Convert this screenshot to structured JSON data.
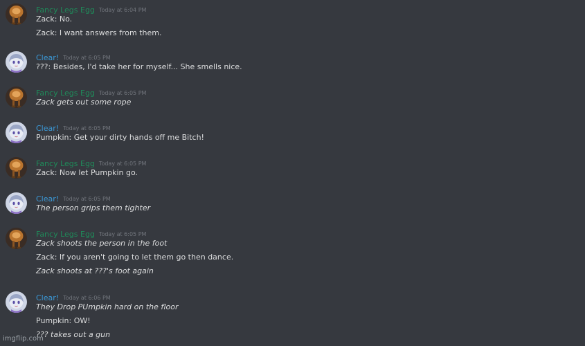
{
  "users": {
    "egg": {
      "name": "Fancy Legs Egg",
      "color": "#1f8b5a",
      "avatar_icon": "egg-character-avatar"
    },
    "clear": {
      "name": "Clear!",
      "color": "#3b9ad9",
      "avatar_icon": "anime-girl-avatar"
    }
  },
  "messages": [
    {
      "user": "egg",
      "timestamp": "Today at 6:04 PM",
      "lines": [
        {
          "text": "Zack: No.",
          "italic": false
        },
        {
          "text": "Zack: I want answers from them.",
          "italic": false
        }
      ]
    },
    {
      "user": "clear",
      "timestamp": "Today at 6:05 PM",
      "lines": [
        {
          "text": "???: Besides, I'd take her for myself... She smells nice.",
          "italic": false
        }
      ]
    },
    {
      "user": "egg",
      "timestamp": "Today at 6:05 PM",
      "lines": [
        {
          "text": "Zack gets out some rope",
          "italic": true
        }
      ]
    },
    {
      "user": "clear",
      "timestamp": "Today at 6:05 PM",
      "lines": [
        {
          "text": "Pumpkin: Get your dirty hands off me Bitch!",
          "italic": false
        }
      ]
    },
    {
      "user": "egg",
      "timestamp": "Today at 6:05 PM",
      "lines": [
        {
          "text": "Zack: Now let Pumpkin go.",
          "italic": false
        }
      ]
    },
    {
      "user": "clear",
      "timestamp": "Today at 6:05 PM",
      "lines": [
        {
          "text": "The person grips them tighter",
          "italic": true
        }
      ]
    },
    {
      "user": "egg",
      "timestamp": "Today at 6:05 PM",
      "lines": [
        {
          "text": "Zack shoots the person in the foot",
          "italic": true
        },
        {
          "text": "Zack: If you aren't going to let them go then dance.",
          "italic": false
        },
        {
          "text": "Zack shoots at ???'s foot again",
          "italic": true
        }
      ]
    },
    {
      "user": "clear",
      "timestamp": "Today at 6:06 PM",
      "lines": [
        {
          "text": "They Drop PUmpkin hard on the floor",
          "italic": true
        },
        {
          "text": "Pumpkin: OW!",
          "italic": false
        },
        {
          "text": "??? takes out a gun",
          "italic": true
        }
      ]
    }
  ],
  "watermark": "imgflip.com"
}
